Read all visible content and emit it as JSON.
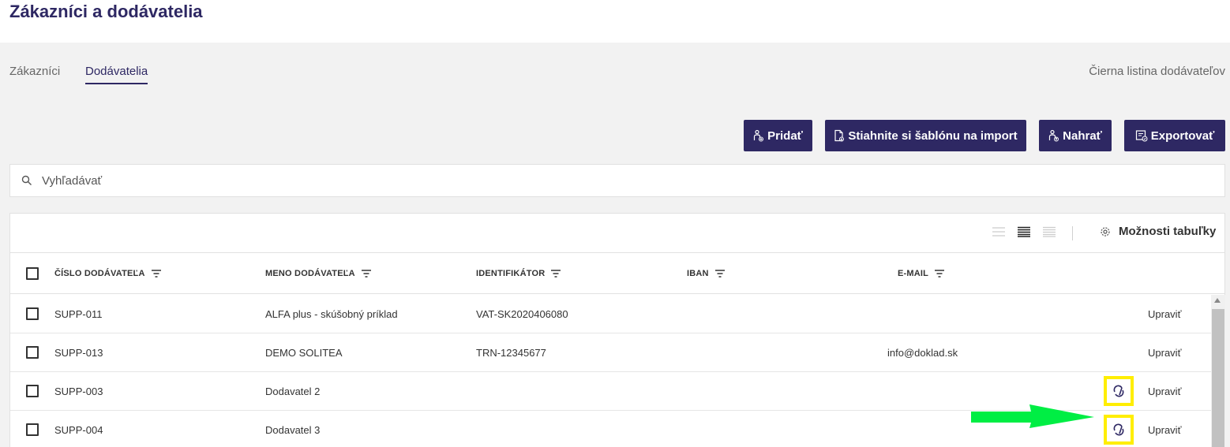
{
  "page": {
    "title": "Zákazníci a dodávatelia"
  },
  "tabs": [
    {
      "label": "Zákazníci",
      "active": false
    },
    {
      "label": "Dodávatelia",
      "active": true
    }
  ],
  "blacklist_link": "Čierna listina dodávateľov",
  "actions": {
    "add": "Pridať",
    "download_template": "Stiahnite si šablónu na import",
    "upload": "Nahrať",
    "export": "Exportovať"
  },
  "search": {
    "placeholder": "Vyhľadávať",
    "value": ""
  },
  "table": {
    "options_label": "Možnosti tabuľky",
    "columns": {
      "supplier_number": "ČÍSLO DODÁVATEĽA",
      "supplier_name": "MENO DODÁVATEĽA",
      "identifier": "IDENTIFIKÁTOR",
      "iban": "IBAN",
      "email": "E-MAIL"
    },
    "rows": [
      {
        "number": "SUPP-011",
        "name": "ALFA plus - skúšobný príklad",
        "identifier": "VAT-SK2020406080",
        "iban": "",
        "email": "",
        "sync": false,
        "action": "Upraviť"
      },
      {
        "number": "SUPP-013",
        "name": "DEMO SOLITEA",
        "identifier": "TRN-12345677",
        "iban": "",
        "email": "info@doklad.sk",
        "sync": false,
        "action": "Upraviť"
      },
      {
        "number": "SUPP-003",
        "name": "Dodavatel 2",
        "identifier": "",
        "iban": "",
        "email": "",
        "sync": true,
        "action": "Upraviť"
      },
      {
        "number": "SUPP-004",
        "name": "Dodavatel 3",
        "identifier": "",
        "iban": "",
        "email": "",
        "sync": true,
        "action": "Upraviť"
      }
    ]
  },
  "colors": {
    "primary": "#2e2863",
    "highlight": "#ffee00",
    "arrow": "#00ee44"
  },
  "icons": {
    "search": "search-icon",
    "filter": "filter-icon",
    "settings": "gear-icon",
    "sync": "sync-icon",
    "add": "person-add-icon",
    "download": "file-download-icon",
    "upload": "person-upload-icon",
    "export": "export-icon"
  }
}
